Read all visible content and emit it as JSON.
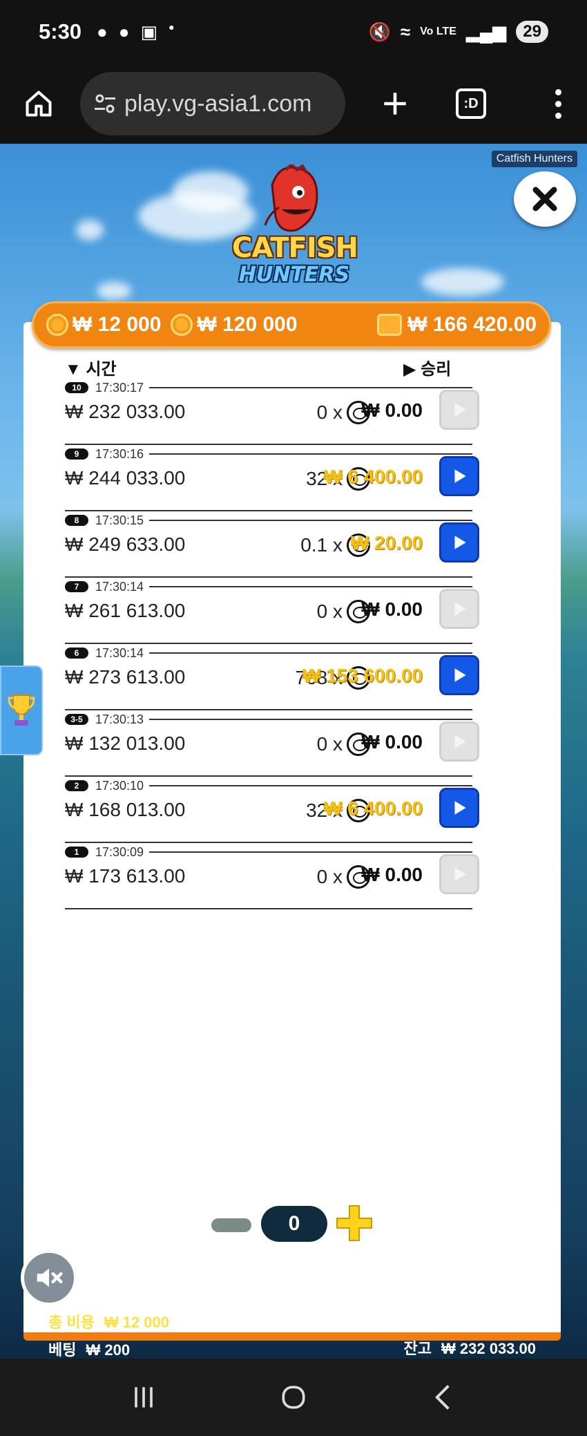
{
  "status_bar": {
    "time": "5:30",
    "battery": "29",
    "network": "Vo LTE"
  },
  "browser": {
    "url": "play.vg-asia1.com",
    "tabs_label": ":D"
  },
  "game": {
    "tag": "Catfish Hunters",
    "logo_line1": "CATFISH",
    "logo_line2": "HUNTERS",
    "balance_bar": {
      "bet_cost": "₩ 12 000",
      "total_bet": "₩ 120 000",
      "wallet": "₩ 166 420.00"
    },
    "headers": {
      "time": "시간",
      "win": "승리"
    },
    "rows": [
      {
        "badge": "10",
        "time": "17:30:17",
        "balance": "₩ 232 033.00",
        "mult": "0 x",
        "win": "₩ 0.00",
        "gold": false,
        "replay": false
      },
      {
        "badge": "9",
        "time": "17:30:16",
        "balance": "₩ 244 033.00",
        "mult": "32 x",
        "win": "₩ 6 400.00",
        "gold": true,
        "replay": true
      },
      {
        "badge": "8",
        "time": "17:30:15",
        "balance": "₩ 249 633.00",
        "mult": "0.1 x",
        "win": "₩ 20.00",
        "gold": true,
        "replay": true
      },
      {
        "badge": "7",
        "time": "17:30:14",
        "balance": "₩ 261 613.00",
        "mult": "0 x",
        "win": "₩ 0.00",
        "gold": false,
        "replay": false
      },
      {
        "badge": "6",
        "time": "17:30:14",
        "balance": "₩ 273 613.00",
        "mult": "768 x",
        "win": "₩ 153 600.00",
        "gold": true,
        "replay": true
      },
      {
        "badge": "3-5",
        "time": "17:30:13",
        "balance": "₩ 132 013.00",
        "mult": "0 x",
        "win": "₩ 0.00",
        "gold": false,
        "replay": false
      },
      {
        "badge": "2",
        "time": "17:30:10",
        "balance": "₩ 168 013.00",
        "mult": "32 x",
        "win": "₩ 6 400.00",
        "gold": true,
        "replay": true
      },
      {
        "badge": "1",
        "time": "17:30:09",
        "balance": "₩ 173 613.00",
        "mult": "0 x",
        "win": "₩ 0.00",
        "gold": false,
        "replay": false
      }
    ],
    "bet_count": "0",
    "footer": {
      "total_cost_label": "총 비용",
      "total_cost_value": "₩ 12 000",
      "bet_label": "베팅",
      "bet_value": "₩ 200",
      "balance_label": "잔고",
      "balance_value": "₩ 232 033.00"
    }
  },
  "colors": {
    "accent_orange": "#f08512",
    "replay_blue": "#1458e8",
    "win_gold": "#f3c21a"
  }
}
